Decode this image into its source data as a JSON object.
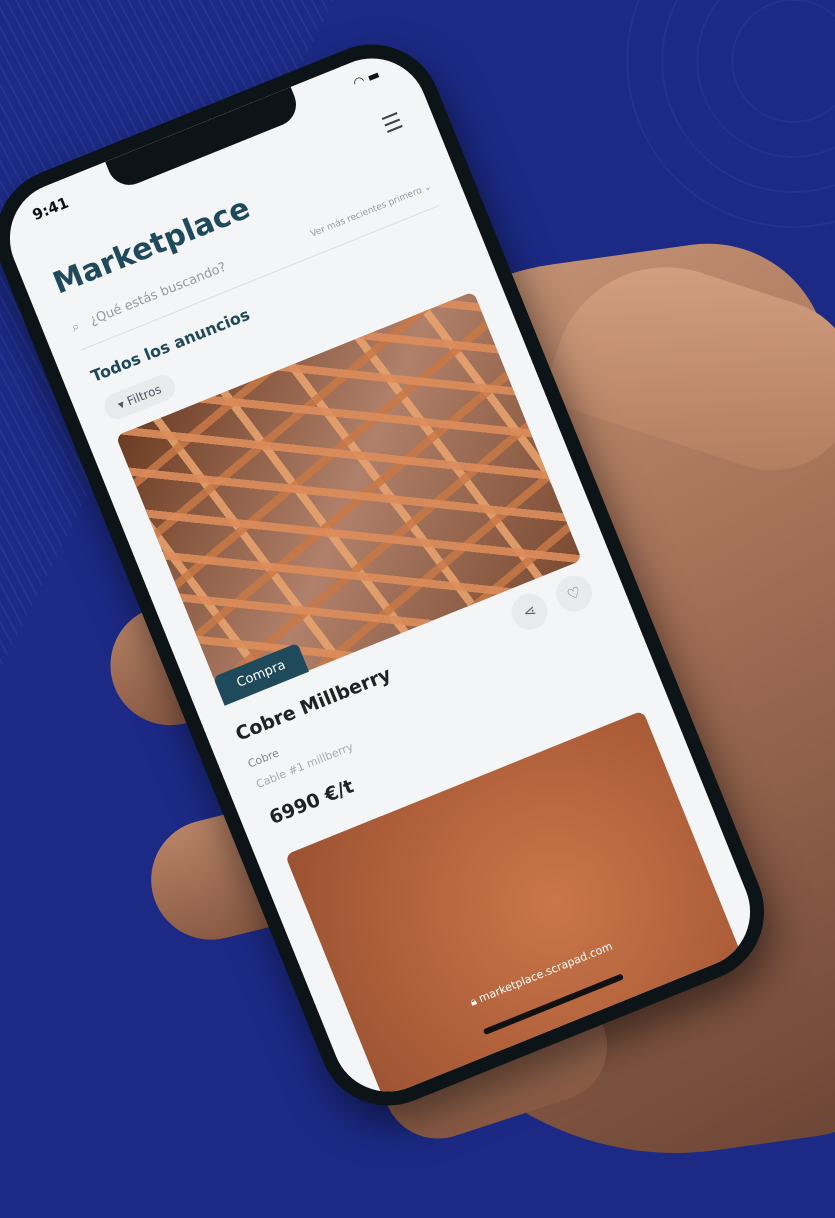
{
  "status": {
    "time": "9:41"
  },
  "app": {
    "title": "Marketplace"
  },
  "search": {
    "placeholder": "¿Qué estás buscando?",
    "sort_label": "Ver más recientes primero"
  },
  "section_title": "Todos los anuncios",
  "filter_button": "Filtros",
  "listing": {
    "badge": "Compra",
    "name": "Cobre Millberry",
    "category": "Cobre",
    "subcategory": "Cable #1 millberry",
    "price": "6990 €/t"
  },
  "browser": {
    "url": "marketplace.scrapad.com"
  },
  "colors": {
    "background": "#1c2a86",
    "accent": "#1f4a5c"
  }
}
